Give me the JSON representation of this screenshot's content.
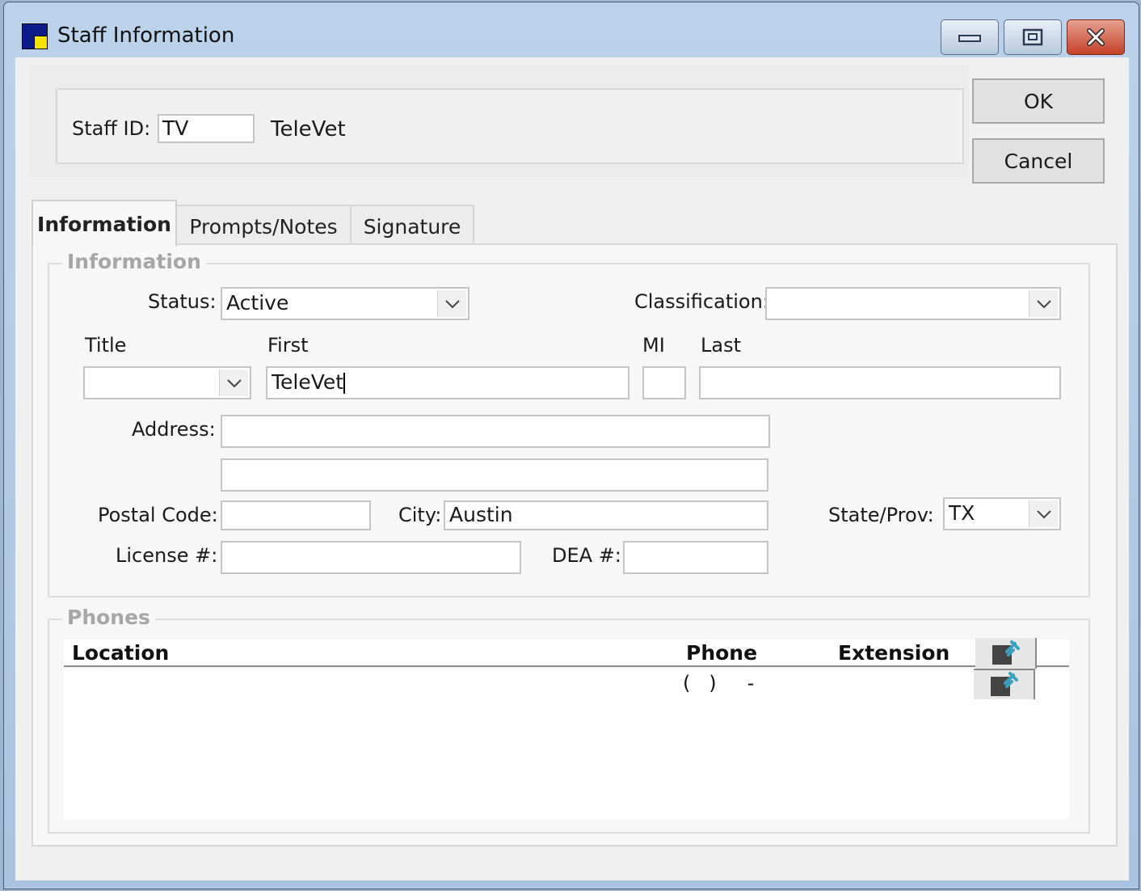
{
  "window": {
    "title": "Staff Information"
  },
  "header": {
    "staff_id_label": "Staff ID:",
    "staff_id_value": "TV",
    "staff_name": "TeleVet"
  },
  "buttons": {
    "ok": "OK",
    "cancel": "Cancel"
  },
  "tabs": [
    {
      "label": "Information",
      "active": true
    },
    {
      "label": "Prompts/Notes",
      "active": false
    },
    {
      "label": "Signature",
      "active": false
    }
  ],
  "info": {
    "group_title": "Information",
    "status_label": "Status:",
    "status_value": "Active",
    "classification_label": "Classification:",
    "classification_value": "",
    "title_label": "Title",
    "title_value": "",
    "first_label": "First",
    "first_value": "TeleVet",
    "mi_label": "MI",
    "mi_value": "",
    "last_label": "Last",
    "last_value": "",
    "address_label": "Address:",
    "address1_value": "",
    "address2_value": "",
    "postal_label": "Postal Code:",
    "postal_value": "",
    "city_label": "City:",
    "city_value": "Austin",
    "state_label": "State/Prov:",
    "state_value": "TX",
    "license_label": "License #:",
    "license_value": "",
    "dea_label": "DEA #:",
    "dea_value": ""
  },
  "phones": {
    "group_title": "Phones",
    "columns": [
      "Location",
      "Phone",
      "Extension"
    ],
    "rows": [
      {
        "location": "",
        "phone": "(   )     -",
        "extension": ""
      }
    ]
  },
  "icons": {
    "app": "app-icon",
    "minimize": "minimize-icon",
    "maximize": "maximize-icon",
    "close": "close-icon",
    "dropdown": "chevron-down-icon",
    "pin": "pin-icon"
  }
}
